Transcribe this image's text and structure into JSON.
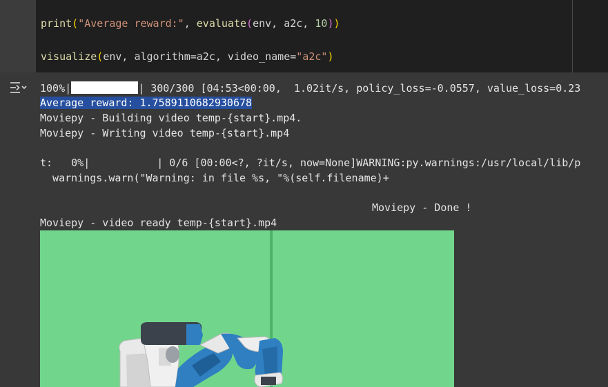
{
  "code": {
    "line1": {
      "fn": "print",
      "paren_open": "(",
      "str": "\"Average reward:\"",
      "sep": ", ",
      "fn2": "evaluate",
      "paren2_open": "(",
      "args": "env, a2c, ",
      "num": "10",
      "paren2_close": ")",
      "paren_close": ")"
    },
    "line2": {
      "fn": "visualize",
      "paren_open": "(",
      "args": "env, algorithm=a2c, video_name=",
      "str": "\"a2c\"",
      "paren_close": ")"
    }
  },
  "output": {
    "progress": {
      "percent_label": "100%|",
      "fraction": 1.0,
      "suffix": "| 300/300 [04:53<00:00,  1.02it/s, policy_loss=-0.0557, value_loss=0.23"
    },
    "reward_line": "Average reward: 1.7589110682930678",
    "building": "Moviepy - Building video temp-{start}.mp4.",
    "writing": "Moviepy - Writing video temp-{start}.mp4",
    "t_line": {
      "prefix": "t:   0%|",
      "suffix": "| 0/6 [00:00<?, ?it/s, now=None]WARNING:py.warnings:/usr/local/lib/p"
    },
    "warn_line": "  warnings.warn(\"Warning: in file %s, \"%(self.filename)+",
    "done_line": "Moviepy - Done !",
    "ready_line": "Moviepy - video ready temp-{start}.mp4"
  },
  "colors": {
    "robot_blue": "#2f7fc1",
    "robot_white": "#e6e6e6",
    "robot_dark": "#3a3f47",
    "floor_green": "#71d58c"
  },
  "icons": {
    "output_toggle": "output-toggle-icon"
  }
}
